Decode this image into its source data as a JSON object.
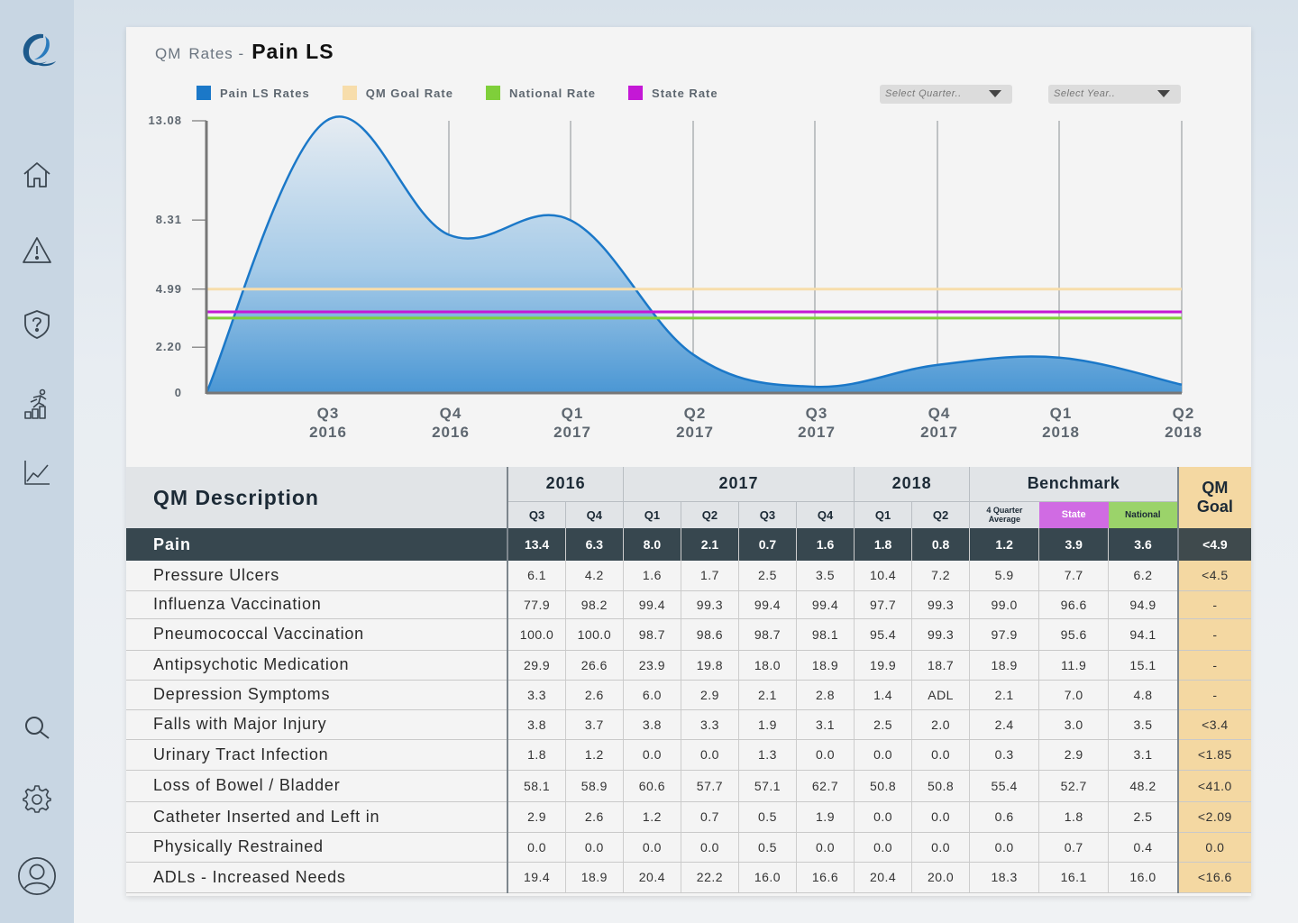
{
  "page": {
    "title_prefix": "QM",
    "title_mid": "Rates -",
    "title_main": "Pain LS"
  },
  "sidebar": {
    "items": [
      {
        "name": "logo",
        "icon": "logo-icon"
      },
      {
        "name": "home",
        "icon": "home-icon"
      },
      {
        "name": "alerts",
        "icon": "warning-icon"
      },
      {
        "name": "security",
        "icon": "shield-question-icon"
      },
      {
        "name": "performance",
        "icon": "runner-chart-icon"
      },
      {
        "name": "analytics",
        "icon": "line-chart-icon"
      },
      {
        "name": "search",
        "icon": "search-icon"
      },
      {
        "name": "settings",
        "icon": "gear-icon"
      },
      {
        "name": "profile",
        "icon": "user-icon"
      }
    ]
  },
  "legend": [
    {
      "label": "Pain LS Rates",
      "color": "#1b78c8"
    },
    {
      "label": "QM Goal Rate",
      "color": "#f7ddab"
    },
    {
      "label": "National Rate",
      "color": "#7fcf3a"
    },
    {
      "label": "State Rate",
      "color": "#c418d6"
    }
  ],
  "filters": {
    "quarter_placeholder": "Select Quarter..",
    "year_placeholder": "Select Year.."
  },
  "chart_data": {
    "type": "area",
    "x": [
      "Q3 2016",
      "Q4 2016",
      "Q1 2017",
      "Q2 2017",
      "Q3 2017",
      "Q4 2017",
      "Q1 2018",
      "Q2 2018"
    ],
    "x_ticks": [
      {
        "q": "Q3",
        "y": "2016"
      },
      {
        "q": "Q4",
        "y": "2016"
      },
      {
        "q": "Q1",
        "y": "2017"
      },
      {
        "q": "Q2",
        "y": "2017"
      },
      {
        "q": "Q3",
        "y": "2017"
      },
      {
        "q": "Q4",
        "y": "2017"
      },
      {
        "q": "Q1",
        "y": "2018"
      },
      {
        "q": "Q2",
        "y": "2018"
      }
    ],
    "y_ticks": [
      "13.08",
      "8.31",
      "4.99",
      "2.20",
      "0"
    ],
    "series": [
      {
        "name": "Pain LS Rates",
        "values": [
          13.08,
          7.6,
          8.3,
          1.85,
          0.3,
          1.35,
          1.7,
          0.4
        ],
        "color": "#1b78c8"
      },
      {
        "name": "QM Goal Rate",
        "values": [
          4.99,
          4.99,
          4.99,
          4.99,
          4.99,
          4.99,
          4.99,
          4.99
        ],
        "color": "#f7ddab"
      },
      {
        "name": "National Rate",
        "values": [
          3.6,
          3.6,
          3.6,
          3.6,
          3.6,
          3.6,
          3.6,
          3.6
        ],
        "color": "#7fcf3a"
      },
      {
        "name": "State Rate",
        "values": [
          3.9,
          3.9,
          3.9,
          3.9,
          3.9,
          3.9,
          3.9,
          3.9
        ],
        "color": "#c418d6"
      }
    ]
  },
  "table": {
    "desc_header": "QM Description",
    "years": [
      "2016",
      "2017",
      "2018"
    ],
    "benchmark_header": "Benchmark",
    "qm_goal_header_1": "QM",
    "qm_goal_header_2": "Goal",
    "quarters": [
      "Q3",
      "Q4",
      "Q1",
      "Q2",
      "Q3",
      "Q4",
      "Q1",
      "Q2"
    ],
    "avg_header_1": "4 Quarter",
    "avg_header_2": "Average",
    "state_header": "State",
    "national_header": "National",
    "highlight_row": {
      "name": "Pain",
      "values": [
        "13.4",
        "6.3",
        "8.0",
        "2.1",
        "0.7",
        "1.6",
        "1.8",
        "0.8",
        "1.2",
        "3.9",
        "3.6",
        "<4.9"
      ]
    },
    "rows": [
      {
        "name": "Pressure Ulcers",
        "values": [
          "6.1",
          "4.2",
          "1.6",
          "1.7",
          "2.5",
          "3.5",
          "10.4",
          "7.2",
          "5.9",
          "7.7",
          "6.2",
          "<4.5"
        ]
      },
      {
        "name": "Influenza Vaccination",
        "values": [
          "77.9",
          "98.2",
          "99.4",
          "99.3",
          "99.4",
          "99.4",
          "97.7",
          "99.3",
          "99.0",
          "96.6",
          "94.9",
          "-"
        ]
      },
      {
        "name": "Pneumococcal Vaccination",
        "values": [
          "100.0",
          "100.0",
          "98.7",
          "98.6",
          "98.7",
          "98.1",
          "95.4",
          "99.3",
          "97.9",
          "95.6",
          "94.1",
          "-"
        ]
      },
      {
        "name": "Antipsychotic Medication",
        "values": [
          "29.9",
          "26.6",
          "23.9",
          "19.8",
          "18.0",
          "18.9",
          "19.9",
          "18.7",
          "18.9",
          "11.9",
          "15.1",
          "-"
        ]
      },
      {
        "name": "Depression Symptoms",
        "values": [
          "3.3",
          "2.6",
          "6.0",
          "2.9",
          "2.1",
          "2.8",
          "1.4",
          "ADL",
          "2.1",
          "7.0",
          "4.8",
          "-"
        ]
      },
      {
        "name": "Falls with Major Injury",
        "values": [
          "3.8",
          "3.7",
          "3.8",
          "3.3",
          "1.9",
          "3.1",
          "2.5",
          "2.0",
          "2.4",
          "3.0",
          "3.5",
          "<3.4"
        ]
      },
      {
        "name": "Urinary Tract Infection",
        "values": [
          "1.8",
          "1.2",
          "0.0",
          "0.0",
          "1.3",
          "0.0",
          "0.0",
          "0.0",
          "0.3",
          "2.9",
          "3.1",
          "<1.85"
        ]
      },
      {
        "name": "Loss of Bowel / Bladder",
        "values": [
          "58.1",
          "58.9",
          "60.6",
          "57.7",
          "57.1",
          "62.7",
          "50.8",
          "50.8",
          "55.4",
          "52.7",
          "48.2",
          "<41.0"
        ]
      },
      {
        "name": "Catheter Inserted and Left in",
        "values": [
          "2.9",
          "2.6",
          "1.2",
          "0.7",
          "0.5",
          "1.9",
          "0.0",
          "0.0",
          "0.6",
          "1.8",
          "2.5",
          "<2.09"
        ]
      },
      {
        "name": "Physically Restrained",
        "values": [
          "0.0",
          "0.0",
          "0.0",
          "0.0",
          "0.5",
          "0.0",
          "0.0",
          "0.0",
          "0.0",
          "0.7",
          "0.4",
          "0.0"
        ]
      },
      {
        "name": "ADLs - Increased Needs",
        "values": [
          "19.4",
          "18.9",
          "20.4",
          "22.2",
          "16.0",
          "16.6",
          "20.4",
          "20.0",
          "18.3",
          "16.1",
          "16.0",
          "<16.6"
        ]
      }
    ]
  }
}
